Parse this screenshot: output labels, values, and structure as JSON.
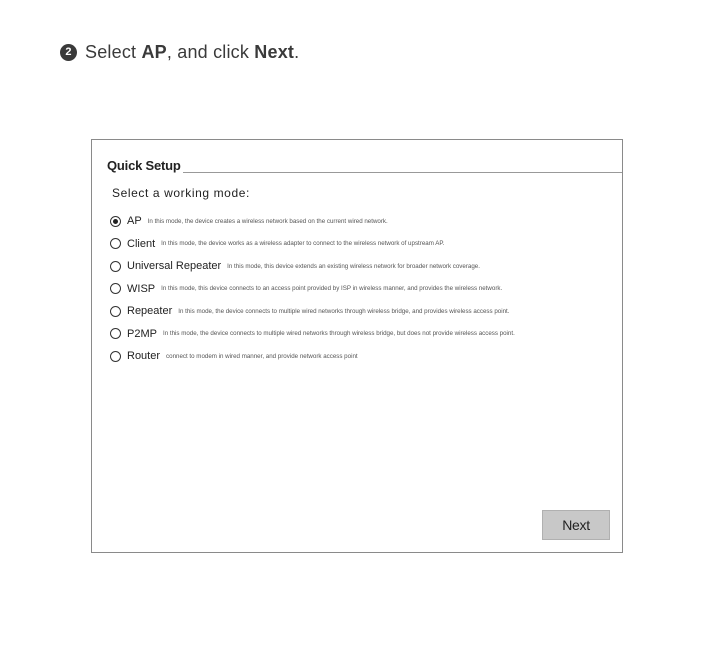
{
  "instruction": {
    "step_number": "2",
    "prefix": "Select ",
    "mode": "AP",
    "middle": ", and click ",
    "button": "Next",
    "suffix": "."
  },
  "quick_setup": {
    "title": "Quick Setup",
    "prompt": "Select a working mode:",
    "options": [
      {
        "name": "AP",
        "desc": "In this mode, the device creates a wireless network based on the current wired network.",
        "selected": true
      },
      {
        "name": "Client",
        "desc": "In this mode, the device works as a wireless adapter to connect to the wireless network of upstream AP.",
        "selected": false
      },
      {
        "name": "Universal Repeater",
        "desc": "In this mode, this device extends an existing wireless network for broader network coverage.",
        "selected": false
      },
      {
        "name": "WISP",
        "desc": "In this mode, this device connects to an access point provided by ISP in wireless manner, and provides the wireless network.",
        "selected": false
      },
      {
        "name": "Repeater",
        "desc": "In this mode, the device connects to multiple wired networks through wireless bridge, and provides wireless access point.",
        "selected": false
      },
      {
        "name": "P2MP",
        "desc": "In this mode, the device connects to multiple wired networks through wireless bridge, but does not provide wireless access point.",
        "selected": false
      },
      {
        "name": "Router",
        "desc": "connect to modem in wired manner, and provide network access point",
        "selected": false
      }
    ],
    "next_label": "Next"
  }
}
